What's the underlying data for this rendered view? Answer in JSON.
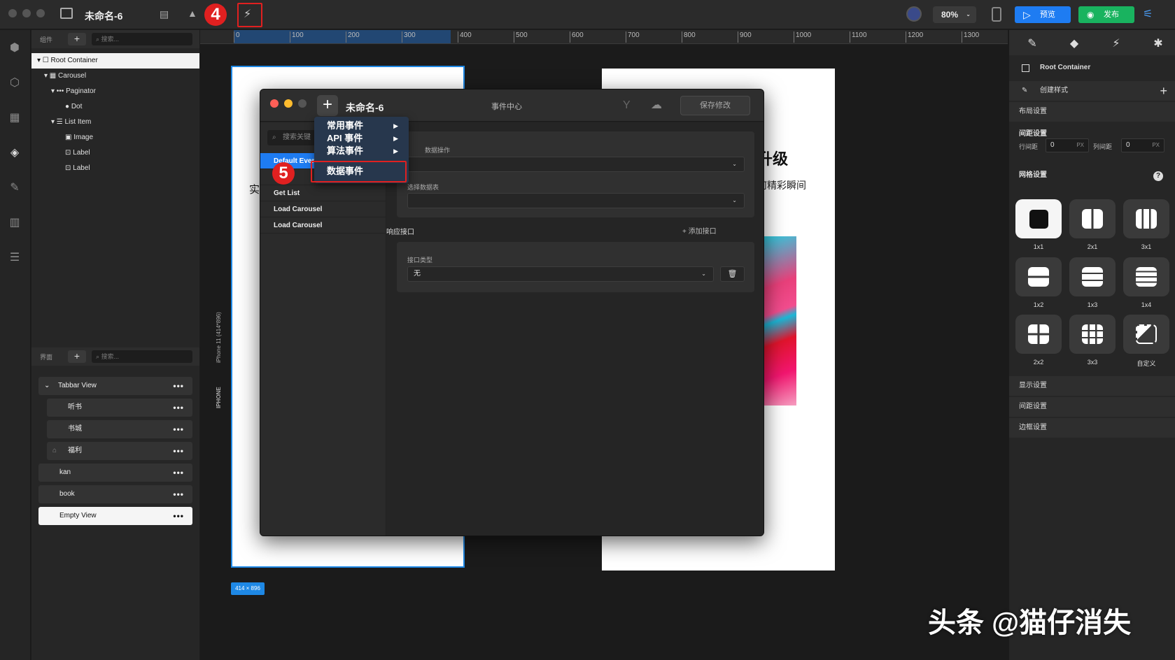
{
  "titlebar": {
    "doc_title": "未命名-6",
    "step4": "4",
    "zoom": "80%",
    "preview_label": "预览",
    "publish_label": "发布"
  },
  "components_panel": {
    "label": "组件",
    "add": "+",
    "search_placeholder": "搜索...",
    "tree": [
      {
        "label": "Root Container"
      },
      {
        "label": "Carousel"
      },
      {
        "label": "Paginator"
      },
      {
        "label": "Dot"
      },
      {
        "label": "List Item"
      },
      {
        "label": "Image"
      },
      {
        "label": "Label"
      },
      {
        "label": "Label"
      }
    ]
  },
  "pages_panel": {
    "label": "界面",
    "add": "+",
    "search_placeholder": "搜索...",
    "pages": [
      {
        "label": "Tabbar View"
      },
      {
        "label": "听书"
      },
      {
        "label": "书城"
      },
      {
        "label": "福利"
      },
      {
        "label": "kan"
      },
      {
        "label": "book"
      },
      {
        "label": "Empty View"
      }
    ],
    "more": "•••"
  },
  "ruler": {
    "ticks": [
      "0",
      "100",
      "200",
      "300",
      "400",
      "500",
      "600",
      "700",
      "800",
      "900",
      "1000",
      "1100",
      "1200",
      "1300"
    ]
  },
  "canvas": {
    "device_label": "IPHONE",
    "device_size_label": "iPhone 11 (414*896)",
    "size_badge": "414 × 896",
    "peek_left": "实",
    "peek_title": "升级",
    "peek_sub": "何精彩瞬间"
  },
  "dialog": {
    "doc_title": "未命名-6",
    "center_title": "事件中心",
    "save_label": "保存修改",
    "search_placeholder": "搜索关键",
    "events": [
      {
        "label": "Default Even"
      },
      {
        "label": "S"
      },
      {
        "label": "Get List"
      },
      {
        "label": "Load Carousel"
      },
      {
        "label": "Load Carousel"
      }
    ],
    "data_op_label": "数据操作",
    "table_label": "选择数据表",
    "response_label": "响应接口",
    "add_api_label": "添加接口",
    "api_type_label": "接口类型",
    "api_type_value": "无"
  },
  "context_menu": {
    "items": [
      {
        "label": "常用事件"
      },
      {
        "label": "API 事件"
      },
      {
        "label": "算法事件"
      },
      {
        "label": "数据事件"
      }
    ],
    "step5": "5"
  },
  "right_panel": {
    "root_label": "Root Container",
    "create_style": "创建样式",
    "layout_settings": "布局设置",
    "spacing_settings": "间距设置",
    "row_gap_label": "行间距",
    "row_gap_value": "0",
    "col_gap_label": "列间距",
    "col_gap_value": "0",
    "unit": "PX",
    "grid_settings": "网格设置",
    "grid_options": [
      "1x1",
      "2x1",
      "3x1",
      "1x2",
      "1x3",
      "1x4",
      "2x2",
      "3x3",
      "自定义"
    ],
    "display_settings": "显示设置",
    "margin_settings": "间距设置",
    "border_settings": "边框设置"
  },
  "watermark": "头条 @猫仔消失",
  "colors": {
    "accent": "#1e7cf2",
    "publish": "#19b35f",
    "highlight": "#e02020"
  }
}
